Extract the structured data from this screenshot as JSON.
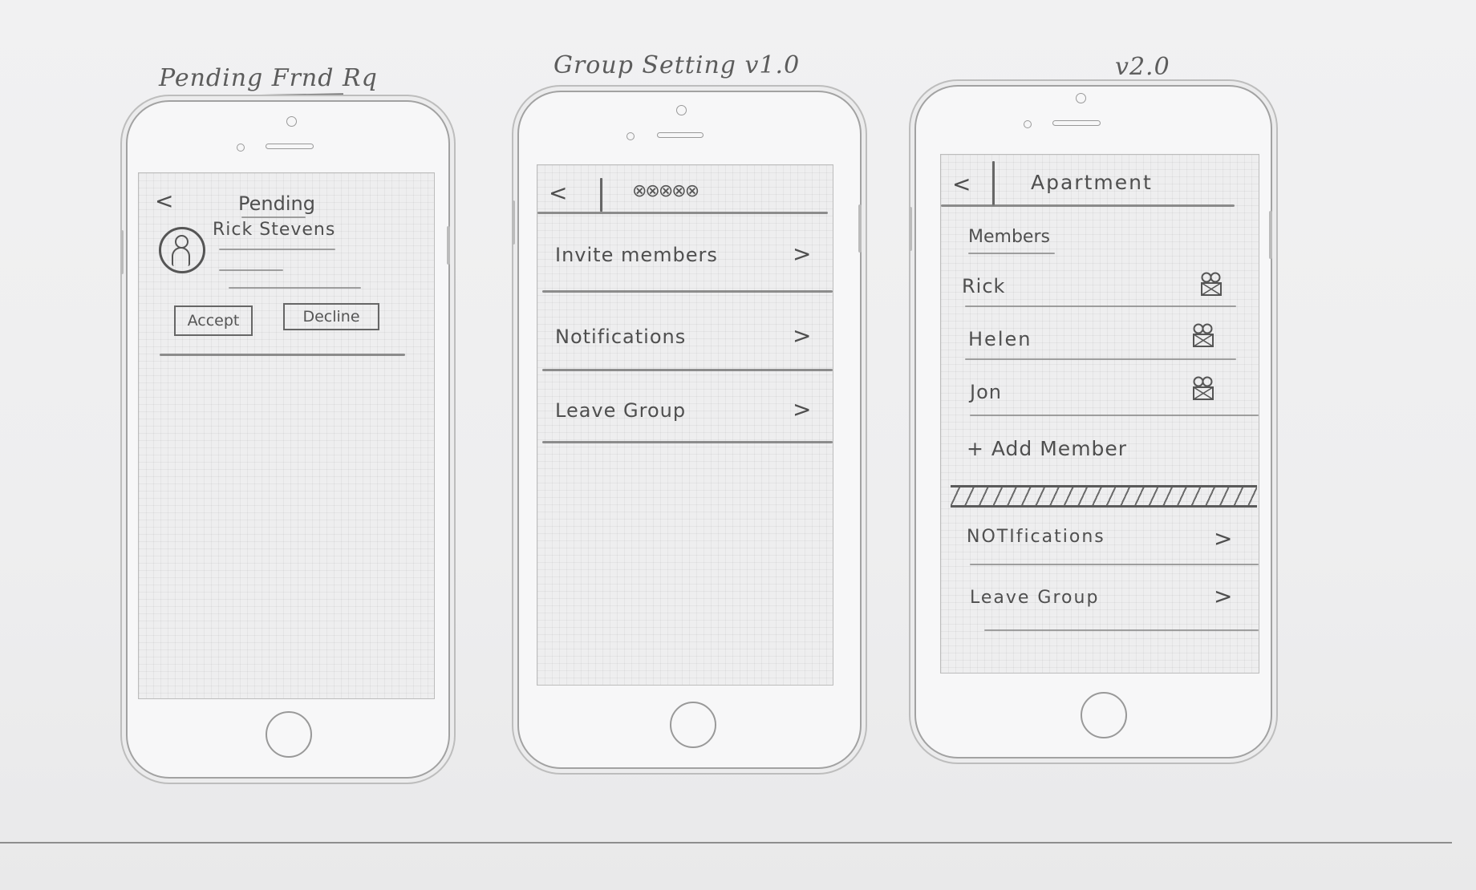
{
  "sheet": {
    "titles": {
      "pending": "Pending Frnd Rq",
      "group_settings": "Group Setting v1.0",
      "v2": "v2.0"
    }
  },
  "phone1": {
    "back": "<",
    "header": "Pending",
    "requester_name": "Rick Stevens",
    "accept_label": "Accept",
    "decline_label": "Decline"
  },
  "phone2": {
    "back": "<",
    "group_name_scribble": "⊗⊗⊗⊗⊗",
    "rows": [
      {
        "label": "Invite members",
        "chevron": ">"
      },
      {
        "label": "Notifications",
        "chevron": ">"
      },
      {
        "label": "Leave Group",
        "chevron": ">"
      }
    ]
  },
  "phone3": {
    "back": "<",
    "group_name": "Apartment",
    "members_header": "Members",
    "members": [
      {
        "name": "Rick"
      },
      {
        "name": "Helen"
      },
      {
        "name": "Jon"
      }
    ],
    "add_member": "+ Add Member",
    "rows": [
      {
        "label": "NOTIfications",
        "chevron": ">"
      },
      {
        "label": "Leave Group",
        "chevron": ">"
      }
    ]
  },
  "icons": {
    "back": "chevron-left-icon",
    "row": "chevron-right-icon",
    "member": "member-status-icon",
    "avatar": "user-avatar-icon"
  }
}
